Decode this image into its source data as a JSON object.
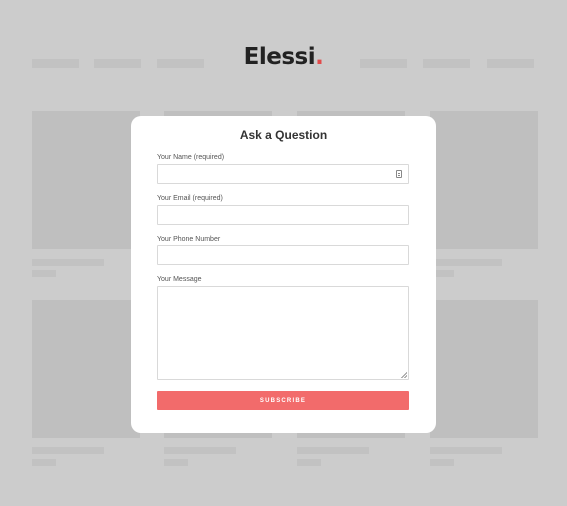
{
  "brand": {
    "name": "Elessi",
    "dot": "."
  },
  "modal": {
    "title": "Ask a Question",
    "fields": {
      "name": {
        "label": "Your Name (required)",
        "value": "",
        "placeholder": ""
      },
      "email": {
        "label": "Your Email (required)",
        "value": "",
        "placeholder": ""
      },
      "phone": {
        "label": "Your Phone Number",
        "value": "",
        "placeholder": ""
      },
      "message": {
        "label": "Your Message",
        "value": "",
        "placeholder": ""
      }
    },
    "submit_label": "SUBSCRIBE",
    "autofill_icon": "contact-card-icon"
  },
  "colors": {
    "accent": "#f26b6b",
    "brand_dot": "#e24b4b",
    "overlay": "#cccccc"
  }
}
